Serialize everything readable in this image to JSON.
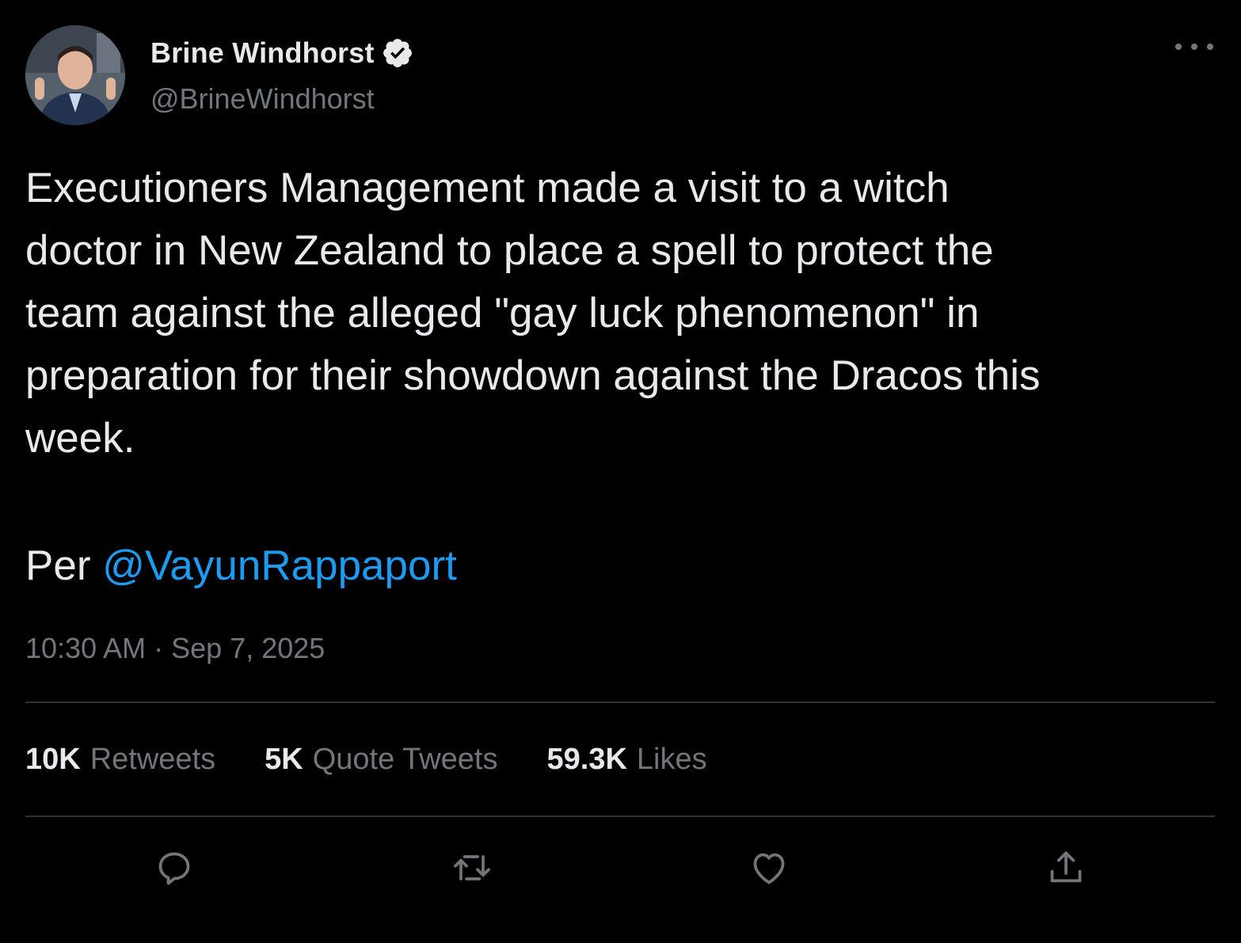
{
  "author": {
    "display_name": "Brine Windhorst",
    "handle": "@BrineWindhorst",
    "verified": true,
    "avatar_icon": "person-avatar"
  },
  "tweet": {
    "text": "Executioners Management made a visit to a witch\ndoctor in New Zealand to place a spell to protect the\nteam against the alleged \"gay luck phenomenon\" in\npreparation for their showdown against the Dracos this\nweek.",
    "per_prefix": "Per ",
    "mention": "@VayunRappaport",
    "time": "10:30 AM",
    "separator": "·",
    "date": "Sep 7, 2025"
  },
  "stats": {
    "retweets_count": "10K",
    "retweets_label": "Retweets",
    "quotes_count": "5K",
    "quotes_label": "Quote Tweets",
    "likes_count": "59.3K",
    "likes_label": "Likes"
  },
  "actions": [
    "reply-icon",
    "retweet-icon",
    "like-icon",
    "share-icon"
  ],
  "colors": {
    "background": "#000000",
    "text": "#e7e9ea",
    "secondary": "#71767b",
    "link": "#1d9bf0",
    "divider": "#2f3336"
  }
}
